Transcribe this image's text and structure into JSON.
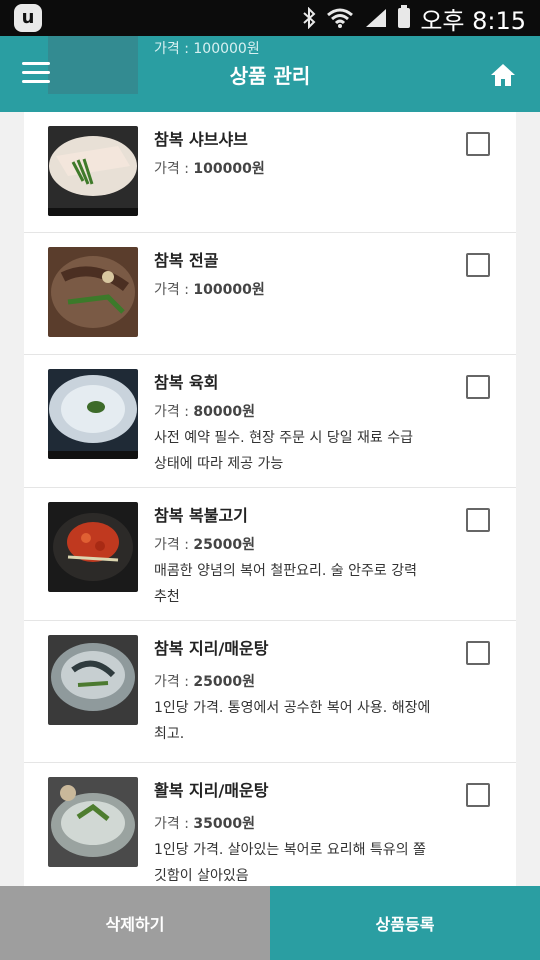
{
  "status_bar": {
    "time": "오후 8:15",
    "icons": [
      "app-icon",
      "bluetooth-icon",
      "wifi-icon",
      "signal-icon",
      "battery-icon"
    ]
  },
  "app_bar": {
    "title": "상품 관리",
    "menu_icon": "menu-icon",
    "home_icon": "home-icon",
    "color": "#2a9ea2"
  },
  "peek_item": {
    "price": "가격 : 100000원"
  },
  "products": [
    {
      "name": "참복 샤브샤브",
      "price_label": "가격 : ",
      "price": "100000원",
      "desc_1": "",
      "desc_2": "",
      "checked": false
    },
    {
      "name": "참복 전골",
      "price_label": "가격 : ",
      "price": "100000원",
      "desc_1": "",
      "desc_2": "",
      "checked": false
    },
    {
      "name": "참복 육회",
      "price_label": "가격 : ",
      "price": "80000원",
      "desc_1": "사전 예약 필수. 현장 주문 시 당일 재료 수급",
      "desc_2": "상태에 따라 제공 가능",
      "checked": false
    },
    {
      "name": "참복 복불고기",
      "price_label": "가격 : ",
      "price": "25000원",
      "desc_1": "매콤한 양념의 복어 철판요리. 술 안주로 강력",
      "desc_2": "추천",
      "checked": false
    },
    {
      "name": "참복 지리/매운탕",
      "price_label": "가격 : ",
      "price": "25000원",
      "desc_1": "1인당 가격. 통영에서 공수한 복어 사용. 해장에",
      "desc_2": "최고.",
      "checked": false
    },
    {
      "name": "활복 지리/매운탕",
      "price_label": "가격 : ",
      "price": "35000원",
      "desc_1": "1인당 가격. 살아있는 복어로 요리해 특유의 쫄",
      "desc_2": "깃함이 살아있음",
      "checked": false
    }
  ],
  "bottom_bar": {
    "delete_label": "삭제하기",
    "register_label": "상품등록",
    "delete_color": "#9e9e9e",
    "register_color": "#2a9ea2"
  }
}
